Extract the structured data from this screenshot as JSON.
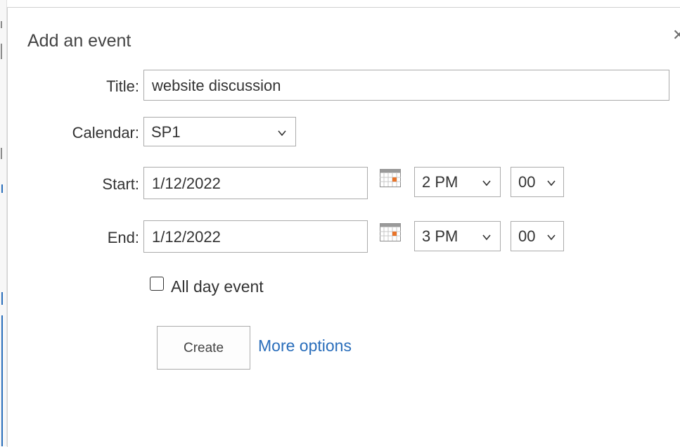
{
  "dialog": {
    "title": "Add an event",
    "close_icon": "close-icon"
  },
  "form": {
    "title_label": "Title:",
    "title_value": "website discussion",
    "calendar_label": "Calendar:",
    "calendar_value": "SP1",
    "start_label": "Start:",
    "start_date": "1/12/2022",
    "start_hour": "2 PM",
    "start_minute": "00",
    "end_label": "End:",
    "end_date": "1/12/2022",
    "end_hour": "3 PM",
    "end_minute": "00",
    "all_day_label": "All day event",
    "all_day_checked": false
  },
  "actions": {
    "create_label": "Create",
    "more_options_label": "More options"
  },
  "colors": {
    "link": "#2a6ebb",
    "border": "#ababab",
    "text": "#333333"
  }
}
